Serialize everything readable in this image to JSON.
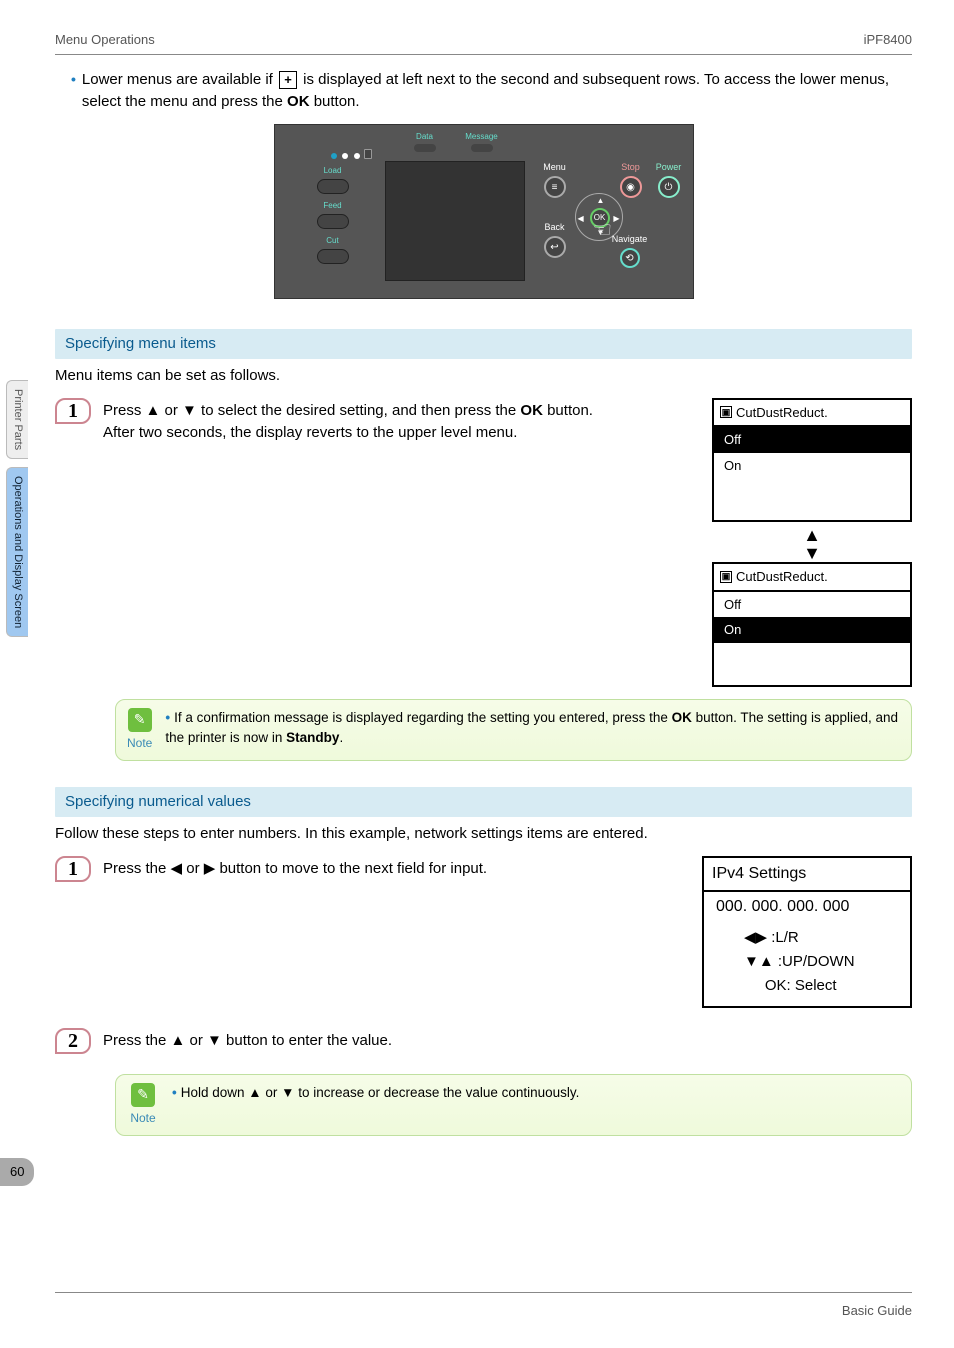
{
  "header": {
    "left": "Menu Operations",
    "right": "iPF8400"
  },
  "intro": {
    "bullet_before": "Lower menus are available if ",
    "bullet_after": " is displayed at left next to the second and subsequent rows. To access the lower menus, select the menu and press the ",
    "bullet_ok": "OK",
    "bullet_end": " button."
  },
  "panel": {
    "load": "Load",
    "feed": "Feed",
    "cut": "Cut",
    "data": "Data",
    "message": "Message",
    "menu": "Menu",
    "back": "Back",
    "ok": "OK",
    "stop": "Stop",
    "power": "Power",
    "navigate": "Navigate"
  },
  "section1": {
    "title": "Specifying menu items",
    "lead": "Menu items can be set as follows.",
    "step1_num": "1",
    "step1_text_a": "Press ▲ or ▼ to select the desired setting, and then press the ",
    "step1_text_ok": "OK",
    "step1_text_b": " button.",
    "step1_text_c": "After two seconds, the display reverts to the upper level menu.",
    "lcd_title": "CutDustReduct.",
    "lcd_off": "Off",
    "lcd_on": "On",
    "note_label": "Note",
    "note_text_a": "If a confirmation message is displayed regarding the setting you entered, press the ",
    "note_text_ok": "OK",
    "note_text_b": " button. The setting is applied, and the printer is now in ",
    "note_text_standby": "Standby",
    "note_text_c": "."
  },
  "section2": {
    "title": "Specifying numerical values",
    "lead": "Follow these steps to enter numbers. In this example, network settings items are entered.",
    "step1_num": "1",
    "step1_text": "Press the ◀ or ▶ button to move to the next field for input.",
    "lcd_title": "IPv4 Settings",
    "lcd_value": "000. 000. 000. 000",
    "help_lr_sym": "◀▶ :",
    "help_lr": "L/R",
    "help_ud_sym": "▼▲ :",
    "help_ud": "UP/DOWN",
    "help_ok": "OK: Select",
    "step2_num": "2",
    "step2_text": "Press the ▲ or ▼ button to enter the value.",
    "note_label": "Note",
    "note_text": "Hold down ▲ or ▼ to increase or decrease the value continuously."
  },
  "side": {
    "tab1": "Printer Parts",
    "tab2": "Operations and Display Screen"
  },
  "page_number": "60",
  "footer": "Basic Guide"
}
